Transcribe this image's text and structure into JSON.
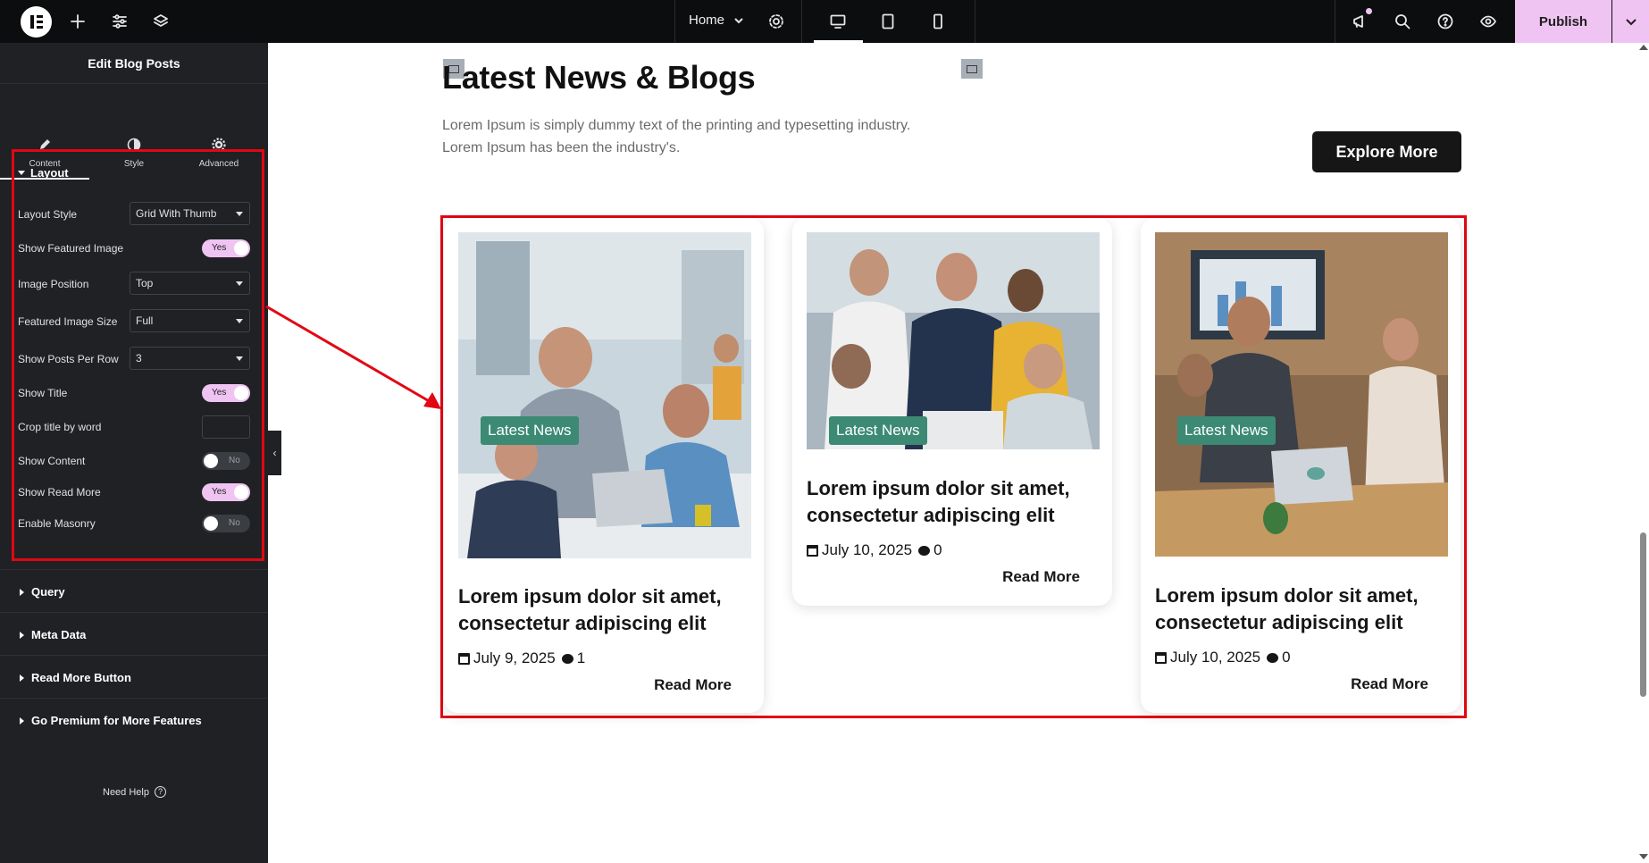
{
  "topbar": {
    "page_name": "Home",
    "publish_label": "Publish",
    "icons": [
      "elementor-logo-icon",
      "plus-icon",
      "sliders-icon",
      "layers-icon",
      "gear-icon",
      "desktop-icon",
      "tablet-icon",
      "mobile-icon",
      "megaphone-icon",
      "search-icon",
      "help-icon",
      "eye-icon",
      "chevron-down-icon"
    ],
    "accent_color": "#f0c4f2"
  },
  "sidebar": {
    "title": "Edit Blog Posts",
    "tabs": [
      {
        "label": "Content",
        "icon": "pencil-icon",
        "active": true
      },
      {
        "label": "Style",
        "icon": "contrast-icon",
        "active": false
      },
      {
        "label": "Advanced",
        "icon": "gear-icon",
        "active": false
      }
    ],
    "layout_section": "Layout",
    "controls": {
      "layout_style_label": "Layout Style",
      "layout_style_value": "Grid With Thumb",
      "show_featured_label": "Show Featured Image",
      "show_featured_value": "Yes",
      "image_position_label": "Image Position",
      "image_position_value": "Top",
      "featured_size_label": "Featured Image Size",
      "featured_size_value": "Full",
      "posts_per_row_label": "Show Posts Per Row",
      "posts_per_row_value": "3",
      "show_title_label": "Show Title",
      "show_title_value": "Yes",
      "crop_title_label": "Crop title by word",
      "crop_title_value": "",
      "show_content_label": "Show Content",
      "show_content_value": "No",
      "show_read_more_label": "Show Read More",
      "show_read_more_value": "Yes",
      "enable_masonry_label": "Enable Masonry",
      "enable_masonry_value": "No"
    },
    "sections": [
      "Query",
      "Meta Data",
      "Read More Button",
      "Go Premium for More Features"
    ],
    "need_help": "Need Help"
  },
  "canvas": {
    "title": "Latest News & Blogs",
    "description": "Lorem Ipsum is simply dummy text of the printing and typesetting industry. Lorem Ipsum has been the industry's.",
    "explore_label": "Explore More",
    "posts": [
      {
        "badge": "Latest News",
        "title": "Lorem ipsum dolor sit amet, consectetur adipiscing elit",
        "date": "July 9, 2025",
        "comments": "1",
        "read_more": "Read More"
      },
      {
        "badge": "Latest News",
        "title": "Lorem ipsum dolor sit amet, consectetur adipiscing elit",
        "date": "July 10, 2025",
        "comments": "0",
        "read_more": "Read More"
      },
      {
        "badge": "Latest News",
        "title": "Lorem ipsum dolor sit amet, consectetur adipiscing elit",
        "date": "July 10, 2025",
        "comments": "0",
        "read_more": "Read More"
      }
    ],
    "highlight_color": "#e30613",
    "badge_color": "#3c8a73"
  }
}
